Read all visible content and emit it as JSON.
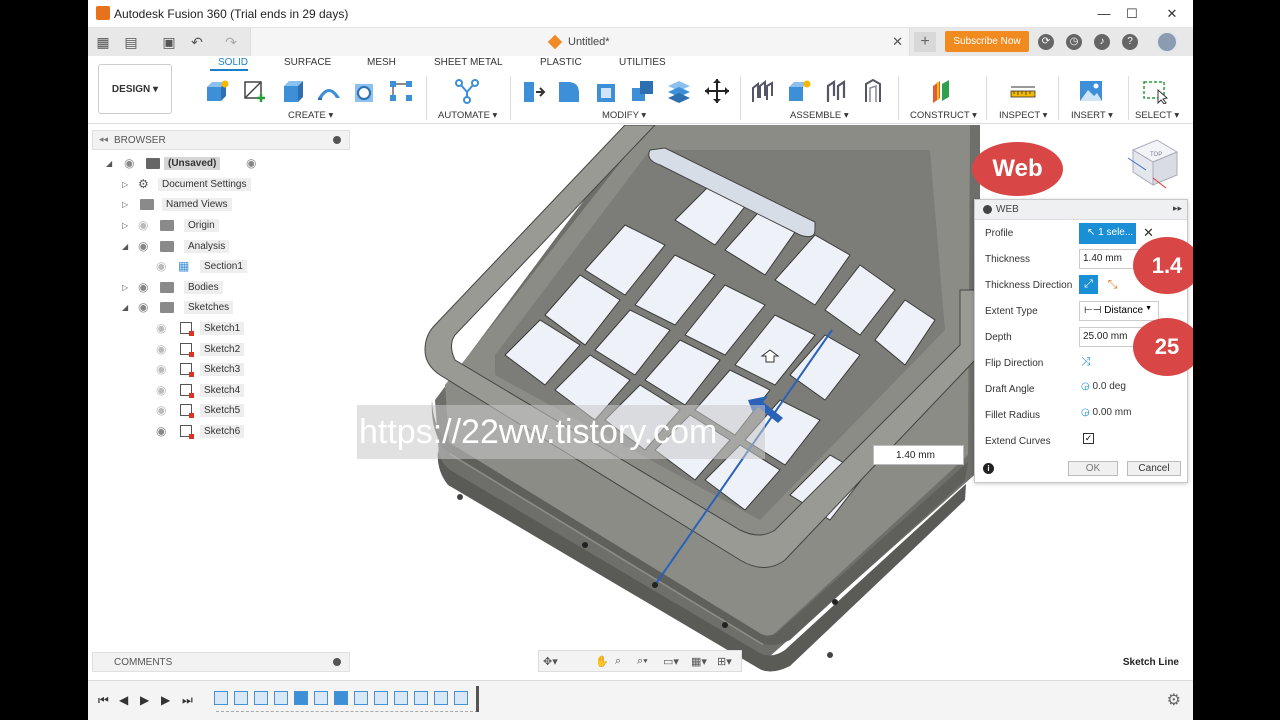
{
  "window": {
    "title": "Autodesk Fusion 360 (Trial ends in 29 days)",
    "minimize": "—",
    "maximize": "☐",
    "close": "✕"
  },
  "tabbar": {
    "doc_name": "Untitled*",
    "close": "✕",
    "plus": "+",
    "subscribe": "Subscribe Now"
  },
  "ribbon": {
    "design": "DESIGN ▾",
    "tabs": [
      "SOLID",
      "SURFACE",
      "MESH",
      "SHEET METAL",
      "PLASTIC",
      "UTILITIES"
    ],
    "groups": [
      "CREATE ▾",
      "AUTOMATE ▾",
      "MODIFY ▾",
      "ASSEMBLE ▾",
      "CONSTRUCT ▾",
      "INSPECT ▾",
      "INSERT ▾",
      "SELECT ▾"
    ]
  },
  "browser": {
    "title": "BROWSER",
    "items": [
      {
        "label": "(Unsaved)"
      },
      {
        "label": "Document Settings"
      },
      {
        "label": "Named Views"
      },
      {
        "label": "Origin"
      },
      {
        "label": "Analysis"
      },
      {
        "label": "Section1"
      },
      {
        "label": "Bodies"
      },
      {
        "label": "Sketches"
      },
      {
        "label": "Sketch1"
      },
      {
        "label": "Sketch2"
      },
      {
        "label": "Sketch3"
      },
      {
        "label": "Sketch4"
      },
      {
        "label": "Sketch5"
      },
      {
        "label": "Sketch6"
      }
    ]
  },
  "comments": {
    "title": "COMMENTS"
  },
  "web_panel": {
    "title": "WEB",
    "profile_label": "Profile",
    "profile_value": "1 sele...",
    "thickness_label": "Thickness",
    "thickness_value": "1.40 mm",
    "thickness_direction_label": "Thickness Direction",
    "extent_type_label": "Extent Type",
    "extent_type_value": "Distance",
    "depth_label": "Depth",
    "depth_value": "25.00 mm",
    "flip_direction_label": "Flip Direction",
    "draft_angle_label": "Draft Angle",
    "draft_angle_value": "0.0 deg",
    "fillet_radius_label": "Fillet Radius",
    "fillet_radius_value": "0.00 mm",
    "extend_curves_label": "Extend Curves",
    "extend_curves_checked": true,
    "ok": "OK",
    "cancel": "Cancel"
  },
  "callouts": {
    "web": "Web",
    "thickness": "1.4",
    "depth": "25"
  },
  "viewport": {
    "watermark": "https://22ww.tistory.com",
    "dim_input": "1.40 mm",
    "status": "Sketch Line",
    "viewcube": "TOP"
  },
  "colors": {
    "accent": "#1a80c8",
    "subscribe": "#f28b1f",
    "callout": "#d94646",
    "model": "#8a8a85"
  }
}
